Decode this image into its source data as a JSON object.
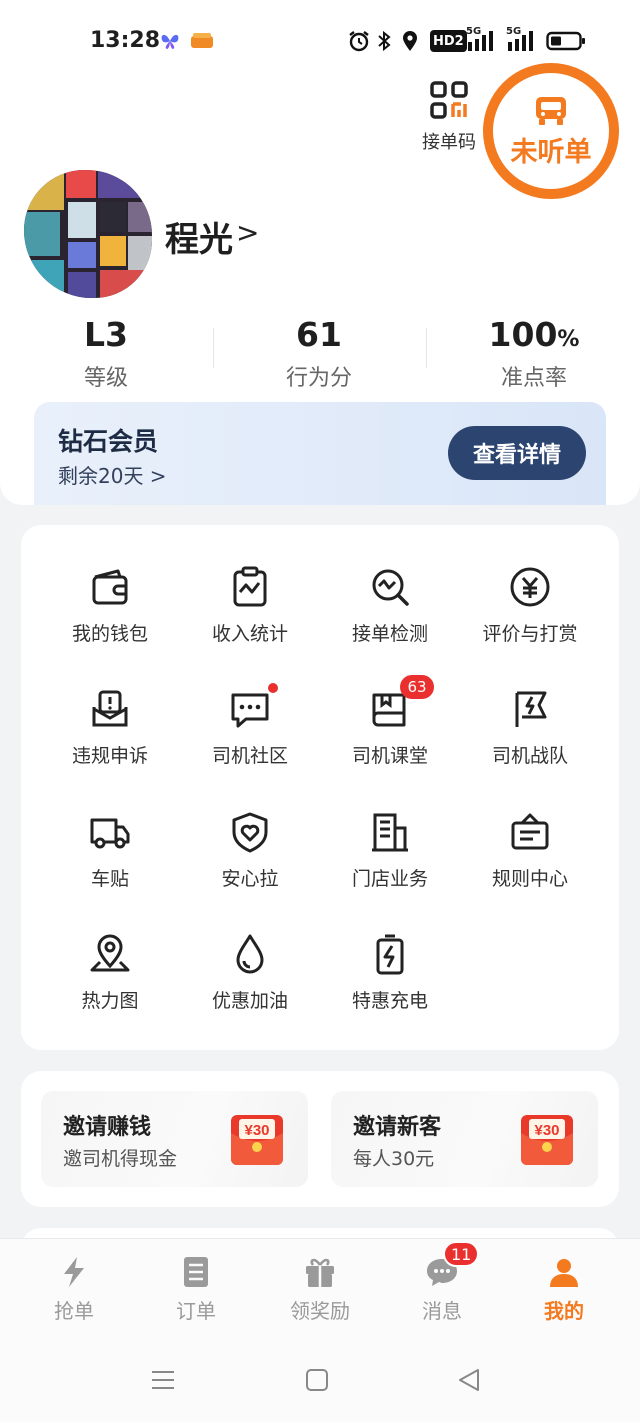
{
  "status_bar": {
    "time": "13:28",
    "hd_label": "HD2",
    "net1": "5G",
    "net2": "5G"
  },
  "header": {
    "qr_label": "接单码",
    "listen_label": "未听单"
  },
  "profile": {
    "name": "程光",
    "chevron": ">"
  },
  "stats": [
    {
      "value": "L3",
      "unit": "",
      "label": "等级"
    },
    {
      "value": "61",
      "unit": "",
      "label": "行为分"
    },
    {
      "value": "100",
      "unit": "%",
      "label": "准点率"
    }
  ],
  "membership": {
    "title": "钻石会员",
    "remaining": "剩余20天 >",
    "button": "查看详情"
  },
  "tools": [
    {
      "label": "我的钱包",
      "icon": "wallet-icon"
    },
    {
      "label": "收入统计",
      "icon": "income-chart-icon"
    },
    {
      "label": "接单检测",
      "icon": "order-check-icon"
    },
    {
      "label": "评价与打赏",
      "icon": "yuan-reward-icon"
    },
    {
      "label": "违规申诉",
      "icon": "appeal-inbox-icon"
    },
    {
      "label": "司机社区",
      "icon": "chat-bubble-icon",
      "badge_dot": true
    },
    {
      "label": "司机课堂",
      "icon": "book-icon",
      "badge": "63"
    },
    {
      "label": "司机战队",
      "icon": "flag-lightning-icon"
    },
    {
      "label": "车贴",
      "icon": "truck-icon"
    },
    {
      "label": "安心拉",
      "icon": "heart-shield-icon"
    },
    {
      "label": "门店业务",
      "icon": "building-icon"
    },
    {
      "label": "规则中心",
      "icon": "rules-board-icon"
    },
    {
      "label": "热力图",
      "icon": "map-pin-icon"
    },
    {
      "label": "优惠加油",
      "icon": "oil-drop-icon"
    },
    {
      "label": "特惠充电",
      "icon": "battery-charge-icon"
    }
  ],
  "invites": [
    {
      "title": "邀请赚钱",
      "subtitle": "邀司机得现金",
      "envelope": "¥30"
    },
    {
      "title": "邀请新客",
      "subtitle": "每人30元",
      "envelope": "¥30"
    }
  ],
  "bottom_nav": [
    {
      "label": "抢单",
      "icon": "lightning-icon"
    },
    {
      "label": "订单",
      "icon": "order-list-icon"
    },
    {
      "label": "领奖励",
      "icon": "gift-icon"
    },
    {
      "label": "消息",
      "icon": "message-icon",
      "badge": "11"
    },
    {
      "label": "我的",
      "icon": "person-icon",
      "active": true
    }
  ],
  "colors": {
    "accent": "#f47a20",
    "badge": "#e9302f",
    "member_button": "#2c4470"
  }
}
